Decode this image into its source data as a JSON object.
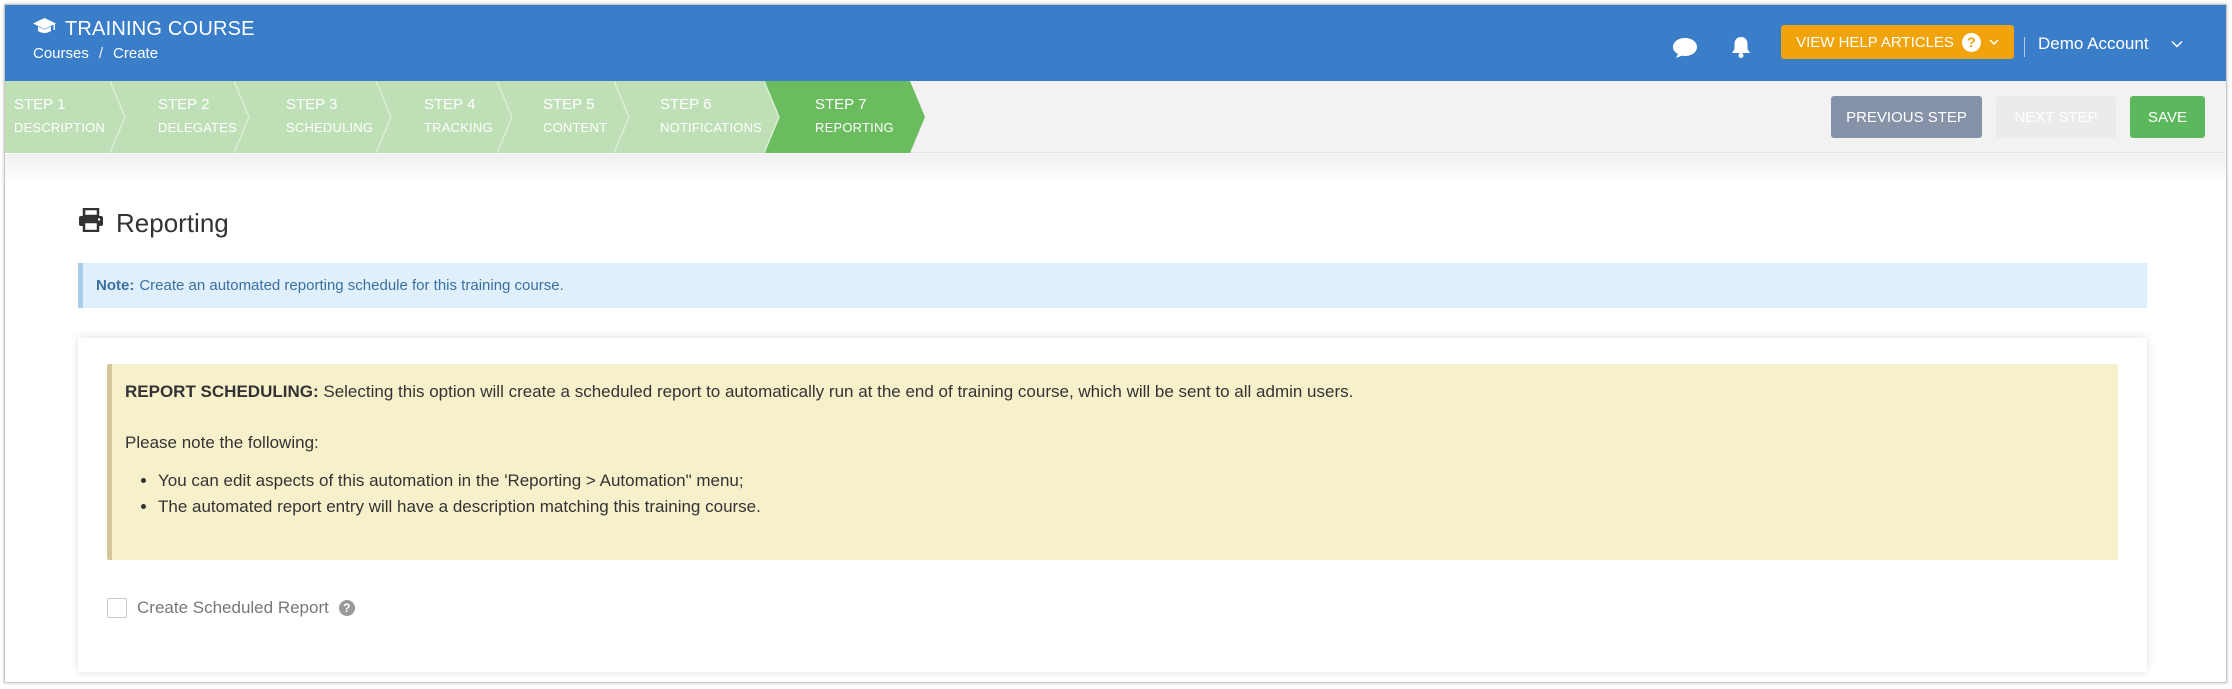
{
  "header": {
    "title": "TRAINING COURSE",
    "breadcrumb": [
      "Courses",
      "/",
      "Create"
    ],
    "help_button": "VIEW HELP ARTICLES",
    "account_name": "Demo Account"
  },
  "steps": [
    {
      "label": "STEP 1",
      "sub": "DESCRIPTION"
    },
    {
      "label": "STEP 2",
      "sub": "DELEGATES"
    },
    {
      "label": "STEP 3",
      "sub": "SCHEDULING"
    },
    {
      "label": "STEP 4",
      "sub": "TRACKING"
    },
    {
      "label": "STEP 5",
      "sub": "CONTENT"
    },
    {
      "label": "STEP 6",
      "sub": "NOTIFICATIONS"
    },
    {
      "label": "STEP 7",
      "sub": "REPORTING"
    }
  ],
  "active_step": 7,
  "actions": {
    "previous": "PREVIOUS STEP",
    "next": "NEXT STEP",
    "save": "SAVE"
  },
  "page": {
    "title": "Reporting",
    "note_label": "Note:",
    "note_text": "Create an automated reporting schedule for this training course."
  },
  "warning": {
    "heading": "REPORT SCHEDULING:",
    "text": "Selecting this option will create a scheduled report to automatically run at the end of training course, which will be sent to all admin users.",
    "intro": "Please note the following:",
    "items": [
      "You can edit aspects of this automation in the 'Reporting > Automation\" menu;",
      "The automated report entry will have a description matching this training course."
    ]
  },
  "checkbox": {
    "label": "Create Scheduled Report",
    "checked": false
  },
  "colors": {
    "header": "#3a7dc9",
    "step_inactive": "#bfe0b6",
    "step_active": "#6bbb5f",
    "help_button": "#f0a30a",
    "save_button": "#5cb85c",
    "previous_button": "#8592a7"
  }
}
